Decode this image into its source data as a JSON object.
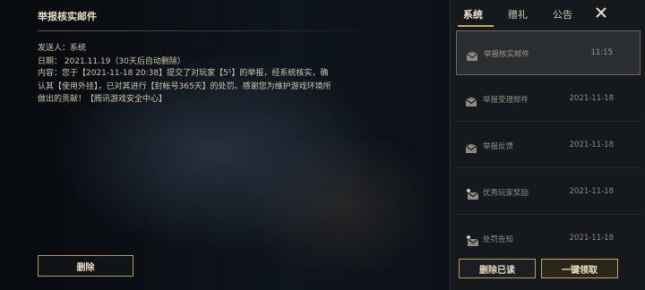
{
  "mail": {
    "title": "举报核实邮件",
    "sender": "发送人：系统",
    "date": "日期： 2021.11.19（30天后自动删除）",
    "content": "内容：您于【2021-11-18 20:38】提交了对玩家【5¹】的举报，经系统核实，确认其【使用外挂】，已对其进行【封帐号365天】的处罚。感谢您为维护游戏环境所做出的贡献！【腾讯游戏安全中心】",
    "delete_label": "删除"
  },
  "tabs": [
    {
      "label": "系统",
      "active": true
    },
    {
      "label": "赠礼",
      "active": false
    },
    {
      "label": "公告",
      "active": false
    }
  ],
  "mail_list": [
    {
      "label": "举报核实邮件",
      "time": "11:15",
      "icon": "mail-icon",
      "selected": true
    },
    {
      "label": "举报受理邮件",
      "time": "2021-11-18",
      "icon": "mail-icon",
      "selected": false
    },
    {
      "label": "举报反馈",
      "time": "2021-11-18",
      "icon": "mail-icon",
      "selected": false
    },
    {
      "label": "优秀玩家奖励",
      "time": "2021-11-18",
      "icon": "reward-mail-icon",
      "selected": false
    },
    {
      "label": "处罚告知",
      "time": "2021-11-18",
      "icon": "reward-mail-icon",
      "selected": false
    }
  ],
  "footer": {
    "delete_read_label": "删除已读",
    "collect_all_label": "一键领取"
  },
  "colors": {
    "accent_gold": "#c8a860",
    "panel_bg": "#15191d",
    "text_main": "#cfc6b0"
  }
}
